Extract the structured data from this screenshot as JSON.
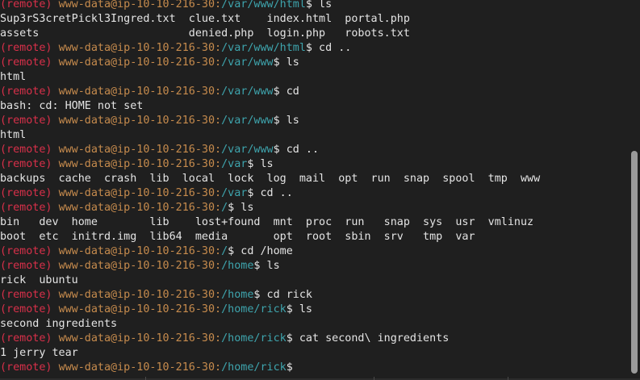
{
  "prompt": {
    "remote": "(remote)",
    "user_host": "www-data@ip-10-10-216-30",
    "colon": ":",
    "dollar": "$"
  },
  "lines": [
    {
      "type": "prompt",
      "path": "/var/www/html",
      "cmd": " ls"
    },
    {
      "type": "output",
      "text": "Sup3rS3cretPickl3Ingred.txt  clue.txt    index.html  portal.php"
    },
    {
      "type": "output",
      "text": "assets                       denied.php  login.php   robots.txt"
    },
    {
      "type": "prompt",
      "path": "/var/www/html",
      "cmd": " cd .."
    },
    {
      "type": "prompt",
      "path": "/var/www",
      "cmd": " ls"
    },
    {
      "type": "output",
      "text": "html"
    },
    {
      "type": "prompt",
      "path": "/var/www",
      "cmd": " cd"
    },
    {
      "type": "output",
      "text": "bash: cd: HOME not set"
    },
    {
      "type": "prompt",
      "path": "/var/www",
      "cmd": " ls"
    },
    {
      "type": "output",
      "text": "html"
    },
    {
      "type": "prompt",
      "path": "/var/www",
      "cmd": " cd .."
    },
    {
      "type": "prompt",
      "path": "/var",
      "cmd": " ls"
    },
    {
      "type": "output",
      "text": "backups  cache  crash  lib  local  lock  log  mail  opt  run  snap  spool  tmp  www"
    },
    {
      "type": "prompt",
      "path": "/var",
      "cmd": " cd .."
    },
    {
      "type": "prompt",
      "path": "/",
      "cmd": " ls"
    },
    {
      "type": "output",
      "text": "bin   dev  home        lib    lost+found  mnt  proc  run   snap  sys  usr  vmlinuz"
    },
    {
      "type": "output",
      "text": "boot  etc  initrd.img  lib64  media       opt  root  sbin  srv   tmp  var"
    },
    {
      "type": "prompt",
      "path": "/",
      "cmd": " cd /home"
    },
    {
      "type": "prompt",
      "path": "/home",
      "cmd": " ls"
    },
    {
      "type": "output",
      "text": "rick  ubuntu"
    },
    {
      "type": "prompt",
      "path": "/home",
      "cmd": " cd rick"
    },
    {
      "type": "prompt",
      "path": "/home/rick",
      "cmd": " ls"
    },
    {
      "type": "output",
      "text": "second ingredients"
    },
    {
      "type": "prompt",
      "path": "/home/rick",
      "cmd": " cat second\\ ingredients"
    },
    {
      "type": "output",
      "text": "1 jerry tear"
    },
    {
      "type": "prompt",
      "path": "/home/rick",
      "cmd": "",
      "cursor": true
    }
  ]
}
